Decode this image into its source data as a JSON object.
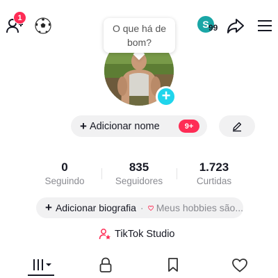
{
  "topbar": {
    "friend_requests_badge": "1",
    "coin_letter": "S",
    "coin_count": "99"
  },
  "profile": {
    "bubble_text_line1": "O que há de",
    "bubble_text_line2": "bom?",
    "add_name_label": "Adicionar nome",
    "name_badge": "9+"
  },
  "stats": [
    {
      "value": "0",
      "label": "Seguindo"
    },
    {
      "value": "835",
      "label": "Seguidores"
    },
    {
      "value": "1.723",
      "label": "Curtidas"
    }
  ],
  "bio": {
    "add_bio_label": "Adicionar biografia",
    "separator": "·",
    "hobbies_hint": "Meus hobbies são..."
  },
  "studio": {
    "label": "TikTok Studio"
  },
  "icons": {
    "add_friend": "add-friend-icon",
    "soccer": "soccer-ball-icon",
    "share": "share-icon",
    "menu": "hamburger-menu-icon",
    "edit": "pencil-icon",
    "heart": "heart-outline-icon",
    "studio": "creator-studio-icon",
    "tab_videos": "videos-grid-icon",
    "tab_private": "lock-icon",
    "tab_saved": "bookmark-icon",
    "tab_liked": "heart-icon"
  },
  "colors": {
    "accent_red": "#fe2c55",
    "add_blue": "#20d5ec",
    "coin_teal": "#1aa6a6",
    "muted_text": "#8a8b91",
    "pill_bg": "#f1f1f2"
  }
}
